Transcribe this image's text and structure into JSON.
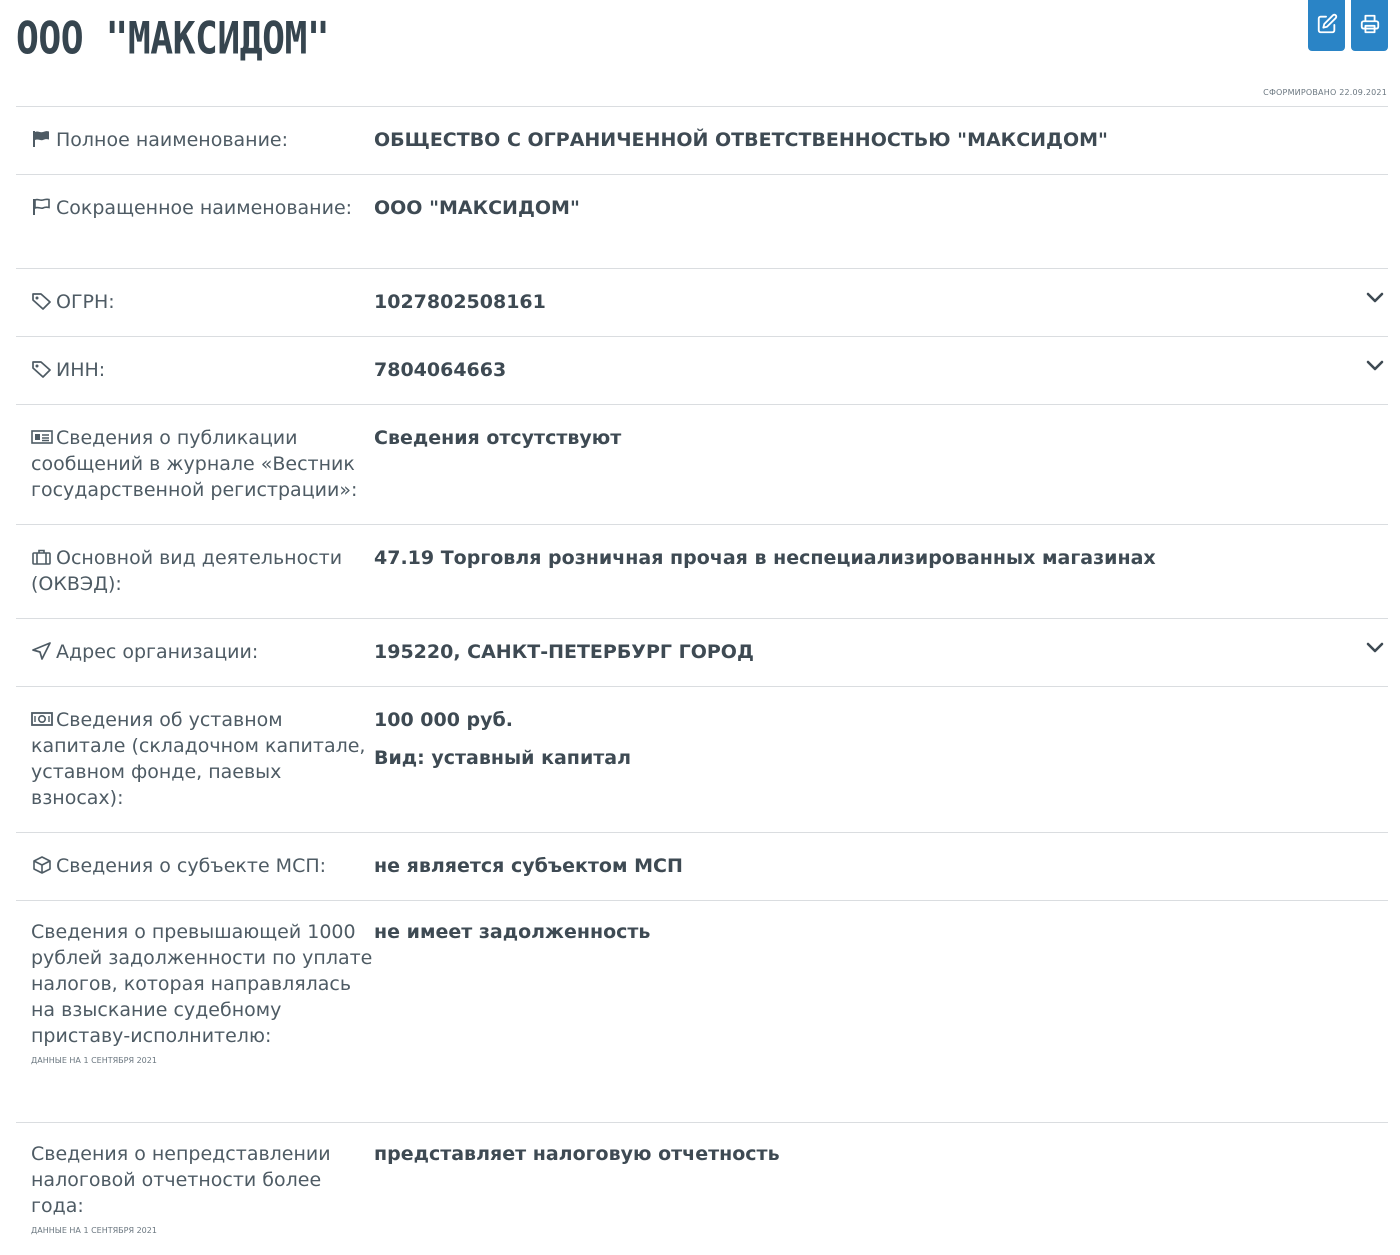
{
  "header": {
    "title": "ООО \"МАКСИДОМ\"",
    "edit_icon": "edit-icon",
    "print_icon": "print-icon",
    "generated": "СФОРМИРОВАНО 22.09.2021"
  },
  "rows": [
    {
      "label": "Полное наименование:",
      "icon": "flag-filled-icon",
      "value": "ОБЩЕСТВО С ОГРАНИЧЕННОЙ ОТВЕТСТВЕННОСТЬЮ \"МАКСИДОМ\""
    },
    {
      "label": "Сокращенное наименование:",
      "icon": "flag-outline-icon",
      "value": "ООО \"МАКСИДОМ\""
    },
    {
      "label": "ОГРН:",
      "icon": "tag-icon",
      "value": "1027802508161",
      "expandable": true
    },
    {
      "label": "ИНН:",
      "icon": "tag-icon",
      "value": "7804064663",
      "expandable": true
    },
    {
      "label": "Сведения о публикации сообщений в журнале «Вестник государственной регистрации»:",
      "icon": "newspaper-icon",
      "value": "Сведения отсутствуют"
    },
    {
      "label": "Основной вид деятельности (ОКВЭД):",
      "icon": "briefcase-icon",
      "value": "47.19 Торговля розничная прочая в неспециализированных магазинах"
    },
    {
      "label": "Адрес организации:",
      "icon": "location-arrow-icon",
      "value": "195220, САНКТ-ПЕТЕРБУРГ ГОРОД",
      "expandable": true
    },
    {
      "label": "Сведения об уставном капитале (складочном капитале, уставном фонде, паевых взносах):",
      "icon": "money-bill-icon",
      "value": "100 000 руб.",
      "value2": "Вид: уставный капитал"
    },
    {
      "label": "Сведения о субъекте МСП:",
      "icon": "cube-icon",
      "value": "не является субъектом МСП"
    },
    {
      "label": "Сведения о превышающей 1000 рублей задолженности по уплате налогов, которая направлялась на взыскание судебному приставу-исполнителю:",
      "note": "ДАННЫЕ НА 1 СЕНТЯБРЯ 2021",
      "value": "не имеет задолженность"
    },
    {
      "label": "Сведения о непредставлении налоговой отчетности более года:",
      "note": "ДАННЫЕ НА 1 СЕНТЯБРЯ 2021",
      "value": "представляет налоговую отчетность"
    }
  ]
}
